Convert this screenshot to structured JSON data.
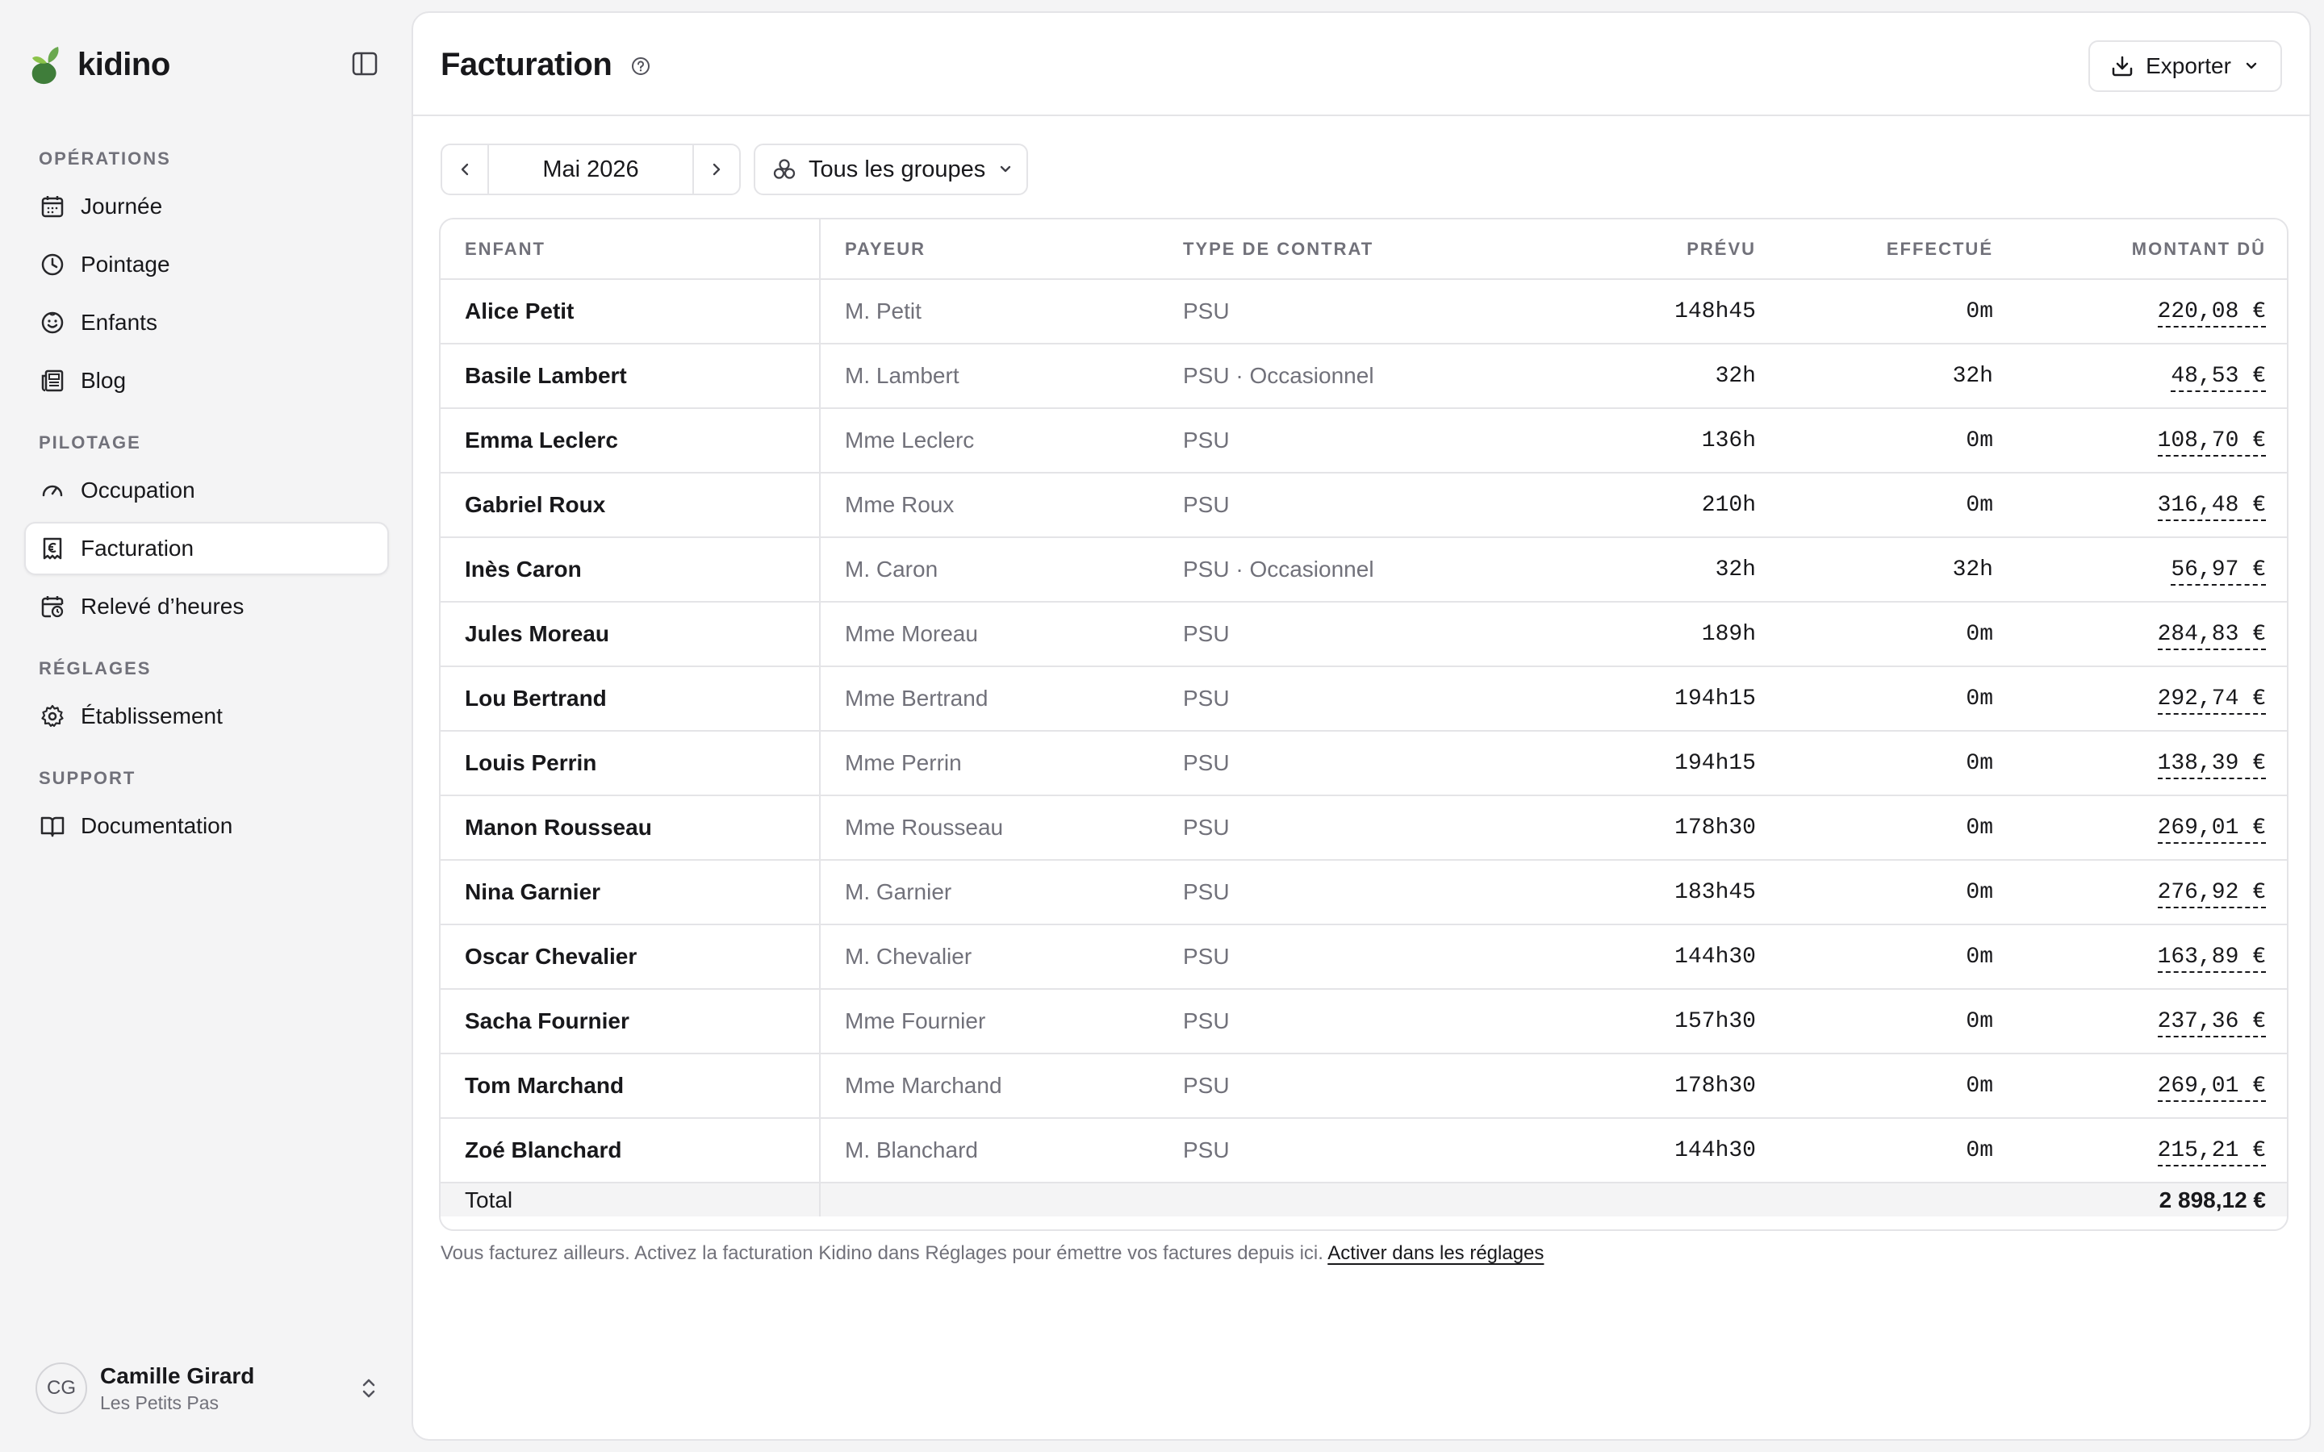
{
  "app": {
    "name": "kidino",
    "brand_color": "#3f7d3a"
  },
  "sidebar": {
    "sections": [
      {
        "label": "OPÉRATIONS",
        "items": [
          {
            "label": "Journée",
            "icon": "calendar-icon"
          },
          {
            "label": "Pointage",
            "icon": "clock-icon"
          },
          {
            "label": "Enfants",
            "icon": "smile-icon"
          },
          {
            "label": "Blog",
            "icon": "newspaper-icon"
          }
        ]
      },
      {
        "label": "PILOTAGE",
        "items": [
          {
            "label": "Occupation",
            "icon": "gauge-icon"
          },
          {
            "label": "Facturation",
            "icon": "receipt-euro-icon",
            "active": true
          },
          {
            "label": "Relevé d’heures",
            "icon": "calendar-clock-icon"
          }
        ]
      },
      {
        "label": "RÉGLAGES",
        "items": [
          {
            "label": "Établissement",
            "icon": "gear-icon"
          }
        ]
      },
      {
        "label": "SUPPORT",
        "items": [
          {
            "label": "Documentation",
            "icon": "book-icon"
          }
        ]
      }
    ],
    "user": {
      "initials": "CG",
      "name": "Camille Girard",
      "org": "Les Petits Pas"
    }
  },
  "header": {
    "title": "Facturation",
    "export_label": "Exporter"
  },
  "filters": {
    "month": "Mai 2026",
    "group": "Tous les groupes"
  },
  "table": {
    "columns": [
      "ENFANT",
      "PAYEUR",
      "TYPE DE CONTRAT",
      "PRÉVU",
      "EFFECTUÉ",
      "MONTANT DÛ"
    ],
    "rows": [
      {
        "enfant": "Alice Petit",
        "payeur": "M. Petit",
        "type": "PSU",
        "prevu": "148h45",
        "effectue": "0m",
        "montant": "220,08 €"
      },
      {
        "enfant": "Basile Lambert",
        "payeur": "M. Lambert",
        "type": "PSU · Occasionnel",
        "prevu": "32h",
        "effectue": "32h",
        "montant": "48,53 €"
      },
      {
        "enfant": "Emma Leclerc",
        "payeur": "Mme Leclerc",
        "type": "PSU",
        "prevu": "136h",
        "effectue": "0m",
        "montant": "108,70 €"
      },
      {
        "enfant": "Gabriel Roux",
        "payeur": "Mme Roux",
        "type": "PSU",
        "prevu": "210h",
        "effectue": "0m",
        "montant": "316,48 €"
      },
      {
        "enfant": "Inès Caron",
        "payeur": "M. Caron",
        "type": "PSU · Occasionnel",
        "prevu": "32h",
        "effectue": "32h",
        "montant": "56,97 €"
      },
      {
        "enfant": "Jules Moreau",
        "payeur": "Mme Moreau",
        "type": "PSU",
        "prevu": "189h",
        "effectue": "0m",
        "montant": "284,83 €"
      },
      {
        "enfant": "Lou Bertrand",
        "payeur": "Mme Bertrand",
        "type": "PSU",
        "prevu": "194h15",
        "effectue": "0m",
        "montant": "292,74 €"
      },
      {
        "enfant": "Louis Perrin",
        "payeur": "Mme Perrin",
        "type": "PSU",
        "prevu": "194h15",
        "effectue": "0m",
        "montant": "138,39 €"
      },
      {
        "enfant": "Manon Rousseau",
        "payeur": "Mme Rousseau",
        "type": "PSU",
        "prevu": "178h30",
        "effectue": "0m",
        "montant": "269,01 €"
      },
      {
        "enfant": "Nina Garnier",
        "payeur": "M. Garnier",
        "type": "PSU",
        "prevu": "183h45",
        "effectue": "0m",
        "montant": "276,92 €"
      },
      {
        "enfant": "Oscar Chevalier",
        "payeur": "M. Chevalier",
        "type": "PSU",
        "prevu": "144h30",
        "effectue": "0m",
        "montant": "163,89 €"
      },
      {
        "enfant": "Sacha Fournier",
        "payeur": "Mme Fournier",
        "type": "PSU",
        "prevu": "157h30",
        "effectue": "0m",
        "montant": "237,36 €"
      },
      {
        "enfant": "Tom Marchand",
        "payeur": "Mme Marchand",
        "type": "PSU",
        "prevu": "178h30",
        "effectue": "0m",
        "montant": "269,01 €"
      },
      {
        "enfant": "Zoé Blanchard",
        "payeur": "M. Blanchard",
        "type": "PSU",
        "prevu": "144h30",
        "effectue": "0m",
        "montant": "215,21 €"
      }
    ],
    "total_label": "Total",
    "total_amount": "2 898,12 €"
  },
  "footer": {
    "note": "Vous facturez ailleurs. Activez la facturation Kidino dans Réglages pour émettre vos factures depuis ici.",
    "link": "Activer dans les réglages"
  }
}
